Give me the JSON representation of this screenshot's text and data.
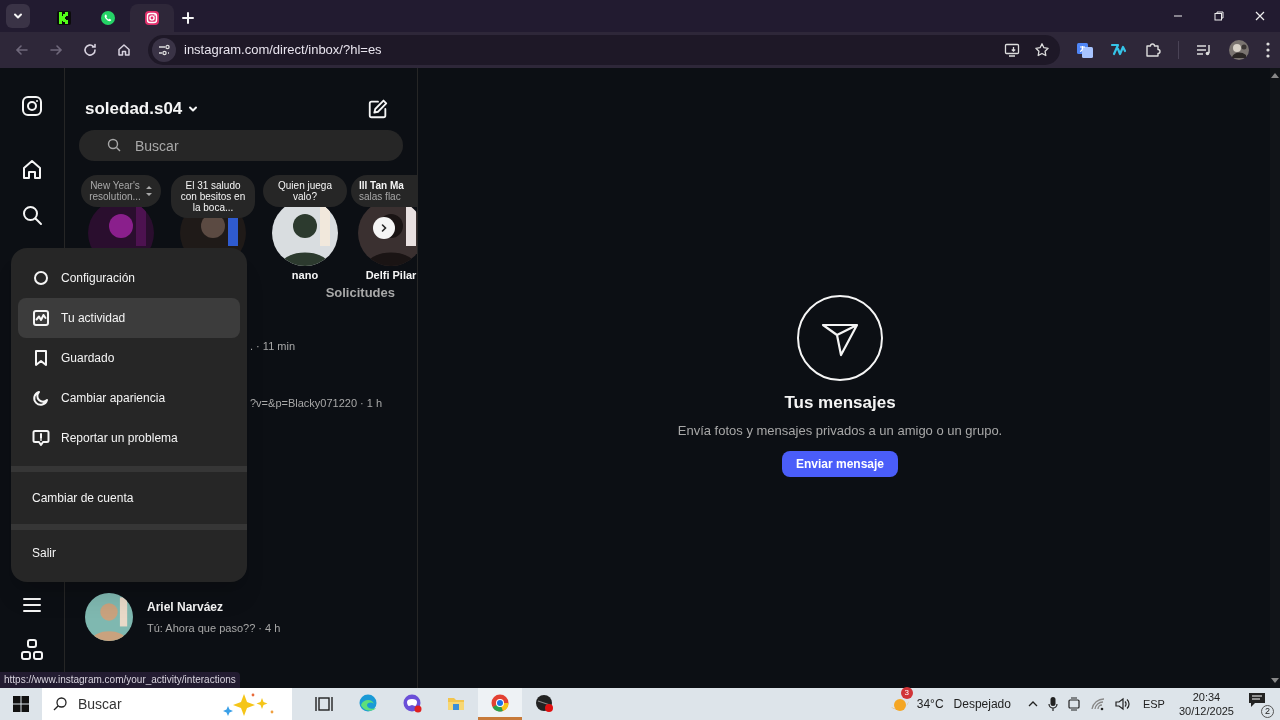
{
  "browser": {
    "tabs": [
      {
        "kind": "kick",
        "selected": false
      },
      {
        "kind": "whatsapp",
        "selected": false
      },
      {
        "kind": "instagram",
        "selected": true
      }
    ],
    "url": "instagram.com/direct/inbox/?hl=es",
    "status_url": "https://www.instagram.com/your_activity/interactions"
  },
  "inbox": {
    "username": "soledad.s04",
    "search": {
      "placeholder": "Buscar"
    },
    "notes": [
      {
        "note": "New Year's resolution...",
        "kind": "muted"
      },
      {
        "note": "El 31 saludo con besitos en la boca...",
        "kind": "plain"
      },
      {
        "note": "Quien juega valo?",
        "kind": "plain",
        "name": "nano"
      },
      {
        "note": "lll Tan Ma",
        "note_2": "salas flac",
        "kind": "cut",
        "name": "Delfi Pilar"
      }
    ],
    "requests_link": "Solicitudes",
    "chats": [
      {
        "preview": ". · 11 min"
      },
      {
        "preview": "?v=&p=Blacky071220 · 1 h"
      },
      {
        "name": "Ariel Narváez",
        "preview": "Tú: Ahora que paso?? · 4 h"
      }
    ]
  },
  "more_menu": {
    "items": [
      {
        "label": "Configuración",
        "kind": "settings",
        "selected": false
      },
      {
        "label": "Tu actividad",
        "kind": "activity",
        "selected": true
      },
      {
        "label": "Guardado",
        "kind": "saved",
        "selected": false
      },
      {
        "label": "Cambiar apariencia",
        "kind": "appearance",
        "selected": false
      },
      {
        "label": "Reportar un problema",
        "kind": "report",
        "selected": false
      }
    ],
    "account_items": [
      "Cambiar de cuenta",
      "Salir"
    ]
  },
  "empty_state": {
    "title": "Tus mensajes",
    "text": "Envía fotos y mensajes privados a un amigo o un grupo.",
    "button": "Enviar mensaje"
  },
  "taskbar": {
    "search": {
      "placeholder": "Buscar"
    },
    "apps": [
      {
        "kind": "taskview",
        "selected": false
      },
      {
        "kind": "edge",
        "selected": false
      },
      {
        "kind": "game",
        "selected": false
      },
      {
        "kind": "folder",
        "selected": false
      },
      {
        "kind": "chrome",
        "selected": true
      },
      {
        "kind": "app",
        "selected": false
      }
    ],
    "weather": {
      "badge": "3",
      "temp": "34°C",
      "condition": "Despejado"
    },
    "language": "ESP",
    "time": "20:34",
    "date": "30/12/2025",
    "notifications": "2"
  }
}
